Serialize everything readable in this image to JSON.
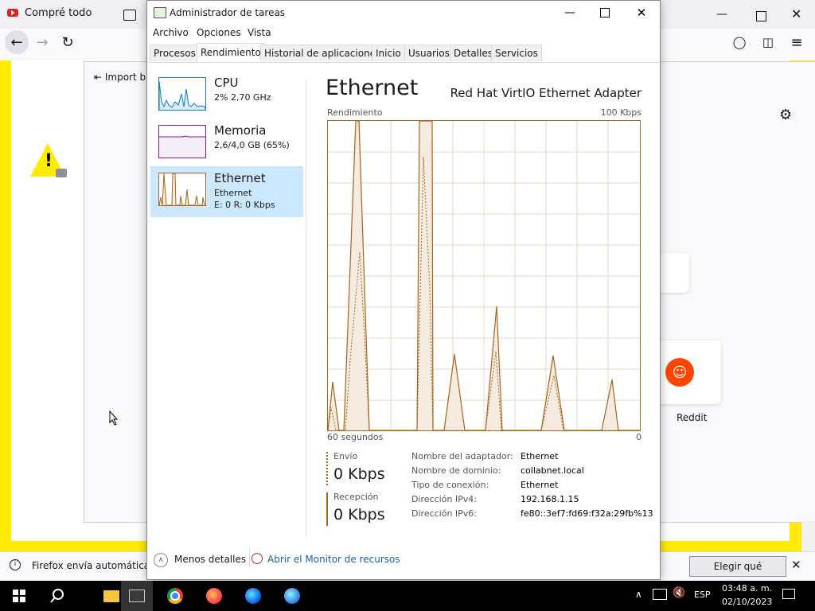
{
  "firefox": {
    "tab_title": "Compré todo",
    "import_label": "Import b",
    "notification_text": "Firefox envía automáticam",
    "share_button": "Elegir qué compartir",
    "site_label": "Reddit"
  },
  "taskbar": {
    "time": "03:48 a. m.",
    "date": "02/10/2023",
    "lang": "ESP"
  },
  "taskmgr": {
    "title": "Administrador de tareas",
    "menu": [
      "Archivo",
      "Opciones",
      "Vista"
    ],
    "tabs": [
      "Procesos",
      "Rendimiento",
      "Historial de aplicaciones",
      "Inicio",
      "Usuarios",
      "Detalles",
      "Servicios"
    ],
    "active_tab": "Rendimiento",
    "resources": [
      {
        "name": "CPU",
        "line1": "2% 2,70 GHz",
        "line2": ""
      },
      {
        "name": "Memoria",
        "line1": "2,6/4,0 GB (65%)",
        "line2": ""
      },
      {
        "name": "Ethernet",
        "line1": "Ethernet",
        "line2": "E: 0 R: 0 Kbps"
      }
    ],
    "detail": {
      "heading": "Ethernet",
      "adapter": "Red Hat VirtIO Ethernet Adapter",
      "graph_label": "Rendimiento",
      "graph_max": "100 Kbps",
      "time_span": "60 segundos",
      "graph_min": "0",
      "send_label": "Envío",
      "send_value": "0 Kbps",
      "recv_label": "Recepción",
      "recv_value": "0 Kbps",
      "props": [
        {
          "key": "Nombre del adaptador:",
          "value": "Ethernet"
        },
        {
          "key": "Nombre de dominio:",
          "value": "collabnet.local"
        },
        {
          "key": "Tipo de conexión:",
          "value": "Ethernet"
        },
        {
          "key": "Dirección IPv4:",
          "value": "192.168.1.15"
        },
        {
          "key": "Dirección IPv6:",
          "value": "fe80::3ef7:fd69:f32a:29fb%13"
        }
      ]
    },
    "footer": {
      "fewer_details": "Menos detalles",
      "resource_monitor": "Abrir el Monitor de recursos"
    }
  },
  "colors": {
    "ethernet_line": "#a5651b",
    "cpu_line": "#117dbb",
    "memory_line": "#8b12ae",
    "selection": "#cce8ff",
    "firefox_yellow": "#ffec00"
  }
}
